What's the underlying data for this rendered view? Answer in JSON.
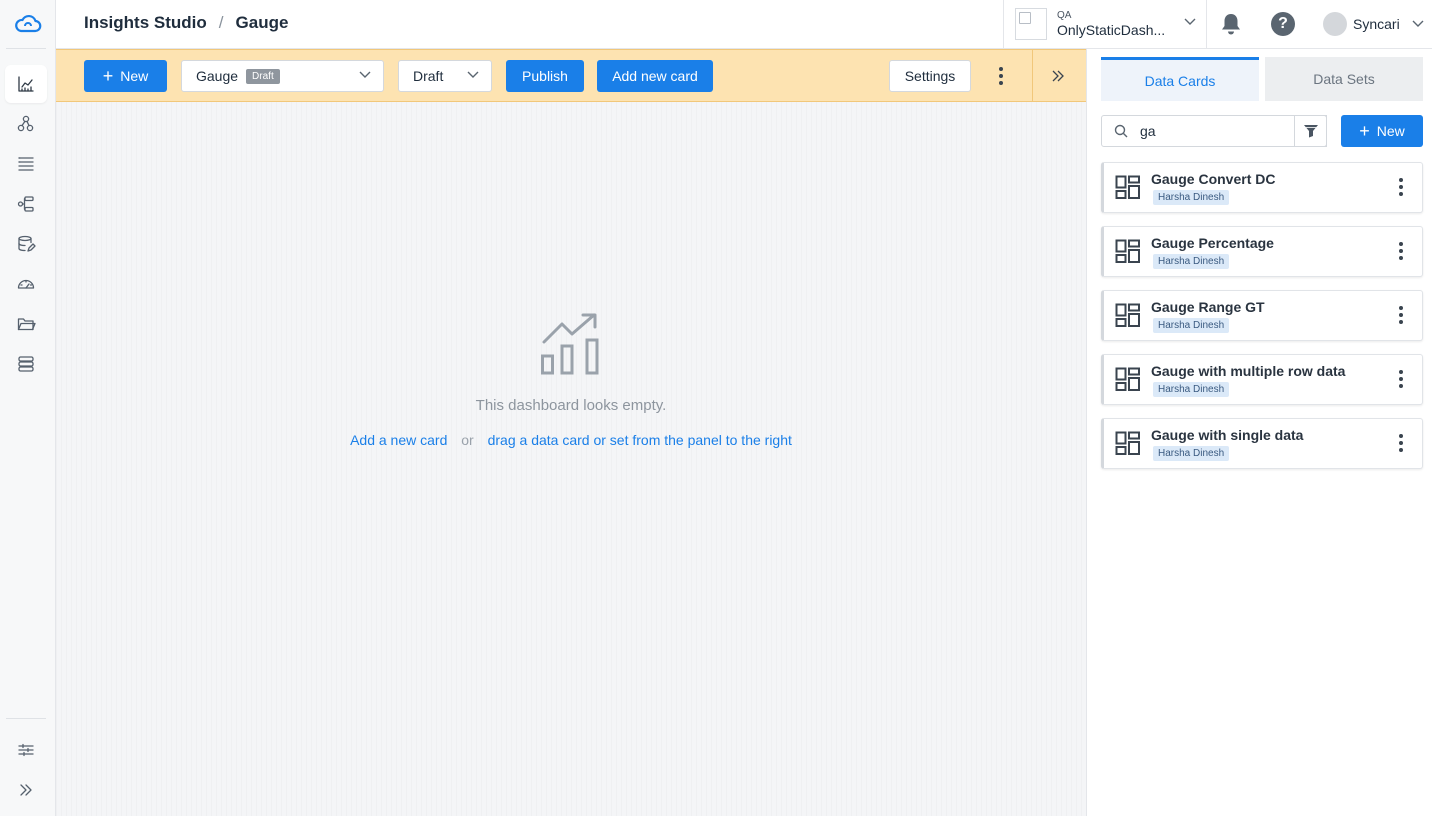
{
  "header": {
    "breadcrumb": [
      "Insights Studio",
      "Gauge"
    ],
    "breadcrumb_separator": "/",
    "tenant": {
      "label": "QA",
      "name": "OnlyStaticDash..."
    },
    "user": {
      "name": "Syncari"
    }
  },
  "rail": {
    "items": [
      "cloud-logo-icon",
      "dashboard-chart-icon",
      "nodes-icon",
      "list-icon",
      "flow-icon",
      "database-edit-icon",
      "speedometer-icon",
      "folder-icon",
      "stack-icon",
      "settings-sliders-icon",
      "expand-icon"
    ]
  },
  "toolbar": {
    "new_label": "New",
    "dashboard_select": "Gauge",
    "dashboard_badge": "Draft",
    "status_select": "Draft",
    "publish_label": "Publish",
    "add_card_label": "Add new card",
    "settings_label": "Settings"
  },
  "canvas": {
    "empty_text": "This dashboard looks empty.",
    "add_card_link": "Add a new card",
    "or_text": "or",
    "drag_link": "drag a data card or set from the panel to the right"
  },
  "panel": {
    "tabs": [
      "Data Cards",
      "Data Sets"
    ],
    "search": {
      "value": "ga"
    },
    "new_label": "New",
    "cards": [
      {
        "title": "Gauge Convert DC",
        "owner": "Harsha Dinesh"
      },
      {
        "title": "Gauge Percentage",
        "owner": "Harsha Dinesh"
      },
      {
        "title": "Gauge Range GT",
        "owner": "Harsha Dinesh"
      },
      {
        "title": "Gauge with multiple row data",
        "owner": "Harsha Dinesh"
      },
      {
        "title": "Gauge with single data",
        "owner": "Harsha Dinesh"
      }
    ]
  },
  "colors": {
    "primary": "#1a7fe8",
    "toolbar_bg": "#fde3b1",
    "badge": "#8f969e"
  }
}
